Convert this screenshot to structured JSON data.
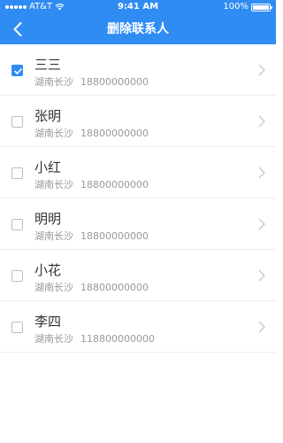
{
  "status_bar": {
    "carrier": "AT&T",
    "time": "9:41 AM",
    "battery": "100%"
  },
  "header": {
    "title": "删除联系人",
    "back_icon": "chevron-left-icon"
  },
  "colors": {
    "primary": "#2f8cf3",
    "text": "#333333",
    "subtext": "#999999",
    "divider": "#ececec"
  },
  "contacts": [
    {
      "name": "三三",
      "location": "湖南长沙",
      "phone": "18800000000",
      "checked": true
    },
    {
      "name": "张明",
      "location": "湖南长沙",
      "phone": "18800000000",
      "checked": false
    },
    {
      "name": "小红",
      "location": "湖南长沙",
      "phone": "18800000000",
      "checked": false
    },
    {
      "name": "明明",
      "location": "湖南长沙",
      "phone": "18800000000",
      "checked": false
    },
    {
      "name": "小花",
      "location": "湖南长沙",
      "phone": "18800000000",
      "checked": false
    },
    {
      "name": "李四",
      "location": "湖南长沙",
      "phone": "118800000000",
      "checked": false
    }
  ]
}
